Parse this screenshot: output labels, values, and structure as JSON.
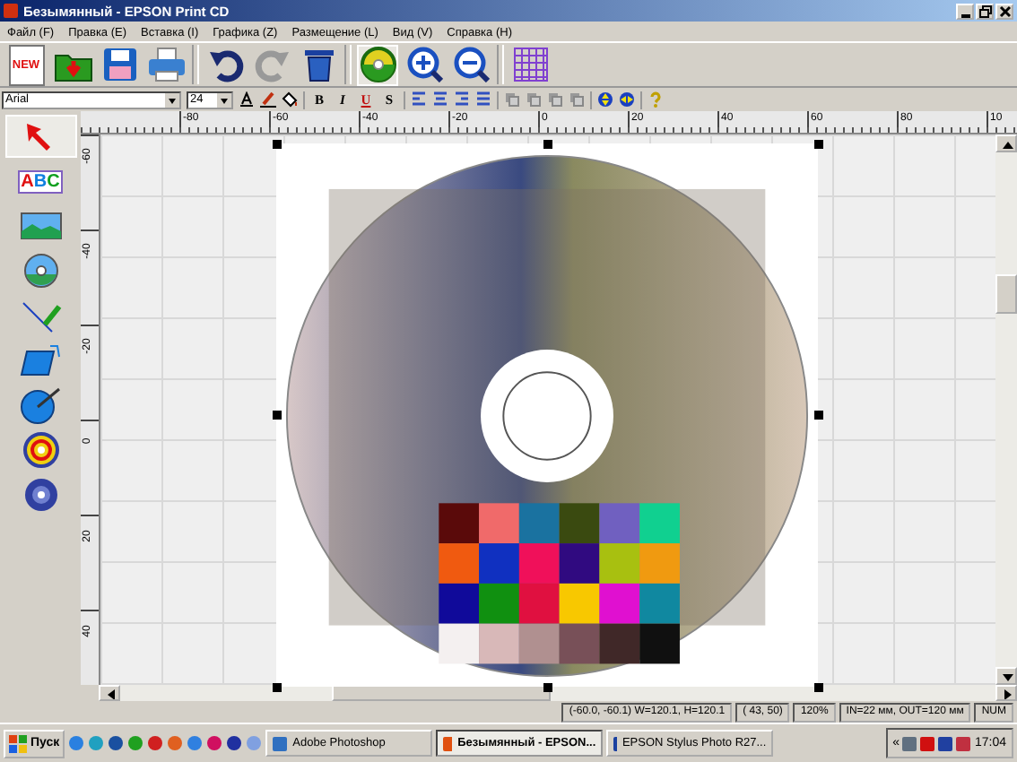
{
  "window": {
    "title": "Безымянный - EPSON Print CD"
  },
  "menu": [
    {
      "label": "Файл (F)"
    },
    {
      "label": "Правка (E)"
    },
    {
      "label": "Вставка (I)"
    },
    {
      "label": "Графика (Z)"
    },
    {
      "label": "Размещение (L)"
    },
    {
      "label": "Вид (V)"
    },
    {
      "label": "Справка (H)"
    }
  ],
  "toolbar": {
    "new_label": "NEW"
  },
  "format_bar": {
    "font": "Arial",
    "size": "24",
    "styles": [
      {
        "label": "B",
        "kind": "bold"
      },
      {
        "label": "I",
        "kind": "italic"
      },
      {
        "label": "U",
        "kind": "underline"
      },
      {
        "label": "S",
        "kind": "shadow"
      }
    ]
  },
  "tools": [
    {
      "kind": "pointer",
      "selected": true
    },
    {
      "kind": "text",
      "selected": false,
      "label": "ABC"
    },
    {
      "kind": "image",
      "selected": false
    },
    {
      "kind": "disc-image",
      "selected": false
    },
    {
      "kind": "line",
      "selected": false
    },
    {
      "kind": "rect",
      "selected": false
    },
    {
      "kind": "circle",
      "selected": false
    },
    {
      "kind": "cd-ring",
      "selected": false
    },
    {
      "kind": "cd-blue",
      "selected": false
    }
  ],
  "ruler": {
    "top_labels": [
      "-80",
      "-60",
      "-40",
      "-20",
      "0",
      "20",
      "40",
      "60",
      "80",
      "10"
    ],
    "left_labels": [
      "-60",
      "-40",
      "-20",
      "0",
      "20",
      "40"
    ]
  },
  "status_bar": [
    "(-60.0, -60.1) W=120.1, H=120.1",
    "(  43,  50)",
    "120%",
    "IN=22 мм, OUT=120 мм",
    "NUM"
  ],
  "taskbar": {
    "start": "Пуск",
    "tasks": [
      {
        "label": "Adobe Photoshop",
        "selected": false
      },
      {
        "label": "Безымянный - EPSON...",
        "selected": true
      },
      {
        "label": "EPSON Stylus Photo R27...",
        "selected": false
      }
    ],
    "tray_label": "«",
    "clock": "17:04"
  }
}
